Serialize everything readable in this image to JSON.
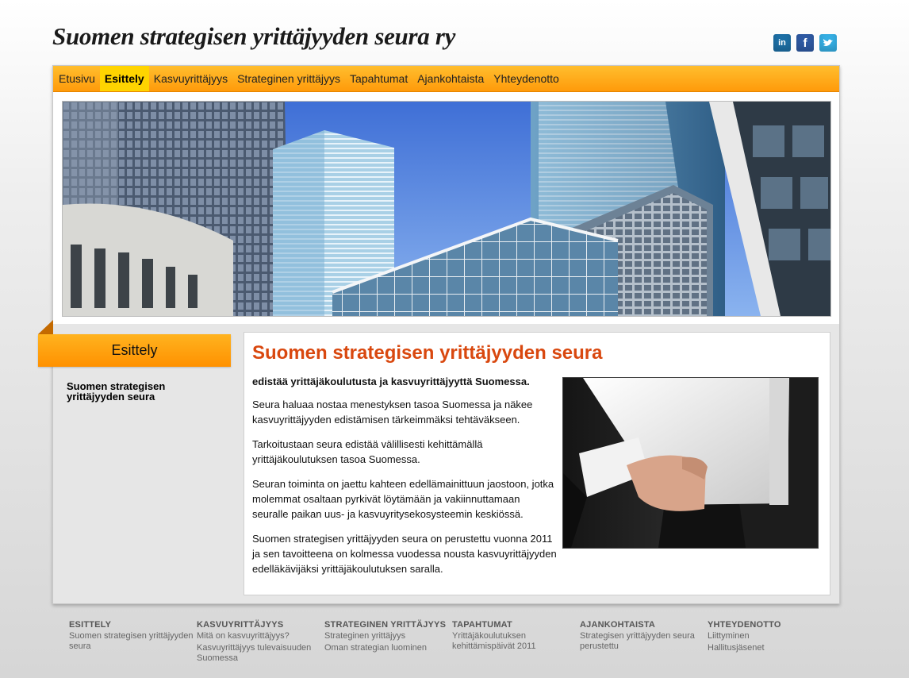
{
  "header": {
    "title": "Suomen strategisen yrittäjyyden seura ry",
    "social": [
      {
        "name": "linkedin-icon",
        "glyph": "in",
        "color": "#1d6fa5"
      },
      {
        "name": "facebook-icon",
        "glyph": "f",
        "color": "#2f5aa3"
      },
      {
        "name": "twitter-icon",
        "glyph": "t",
        "color": "#35aee3"
      }
    ]
  },
  "nav": {
    "items": [
      "Etusivu",
      "Esittely",
      "Kasvuyrittäjyys",
      "Strateginen yrittäjyys",
      "Tapahtumat",
      "Ajankohtaista",
      "Yhteydenotto"
    ],
    "active": "Esittely"
  },
  "sidebar": {
    "heading": "Esittely",
    "link": "Suomen strategisen yrittäjyyden seura"
  },
  "main": {
    "heading": "Suomen strategisen yrittäjyyden seura",
    "lead": "edistää yrittäjäkoulutusta ja kasvuyrittäjyyttä Suomessa.",
    "paragraphs": [
      "Seura haluaa nostaa menestyksen tasoa Suomessa ja näkee kasvuyrittäjyyden edistämisen tärkeimmäksi tehtäväkseen.",
      "Tarkoitustaan seura edistää välillisesti kehittämällä yrittäjäkoulutuksen tasoa Suomessa.",
      "Seuran toiminta on jaettu kahteen edellämainittuun jaostoon, jotka molemmat osaltaan pyrkivät löytämään ja vakiinnuttamaan seuralle paikan uus- ja kasvuyritysekosysteemin keskiössä.",
      "Suomen strategisen yrittäjyyden seura on perustettu vuonna 2011 ja sen tavoitteena on kolmessa vuodessa nousta kasvuyrittäjyyden edelläkävijäksi yrittäjäkoulutuksen saralla."
    ]
  },
  "colors": {
    "accent": "#ff9a0a",
    "heading": "#d9480f",
    "active_nav": "#ffd400"
  },
  "footer": {
    "columns": [
      {
        "title": "ESITTELY",
        "links": [
          "Suomen strategisen yrittäjyyden seura"
        ]
      },
      {
        "title": "KASVUYRITTÄJYYS",
        "links": [
          "Mitä on kasvuyrittäjyys?",
          "Kasvuyrittäjyys tulevaisuuden Suomessa"
        ]
      },
      {
        "title": "STRATEGINEN YRITTÄJYYS",
        "links": [
          "Strateginen yrittäjyys",
          "Oman strategian luominen"
        ]
      },
      {
        "title": "TAPAHTUMAT",
        "links": [
          "Yrittäjäkoulutuksen kehittämispäivät 2011"
        ]
      },
      {
        "title": "AJANKOHTAISTA",
        "links": [
          "Strategisen yrittäjyyden seura perustettu"
        ]
      },
      {
        "title": "YHTEYDENOTTO",
        "links": [
          "Liittyminen",
          "Hallitusjäsenet"
        ]
      }
    ]
  }
}
